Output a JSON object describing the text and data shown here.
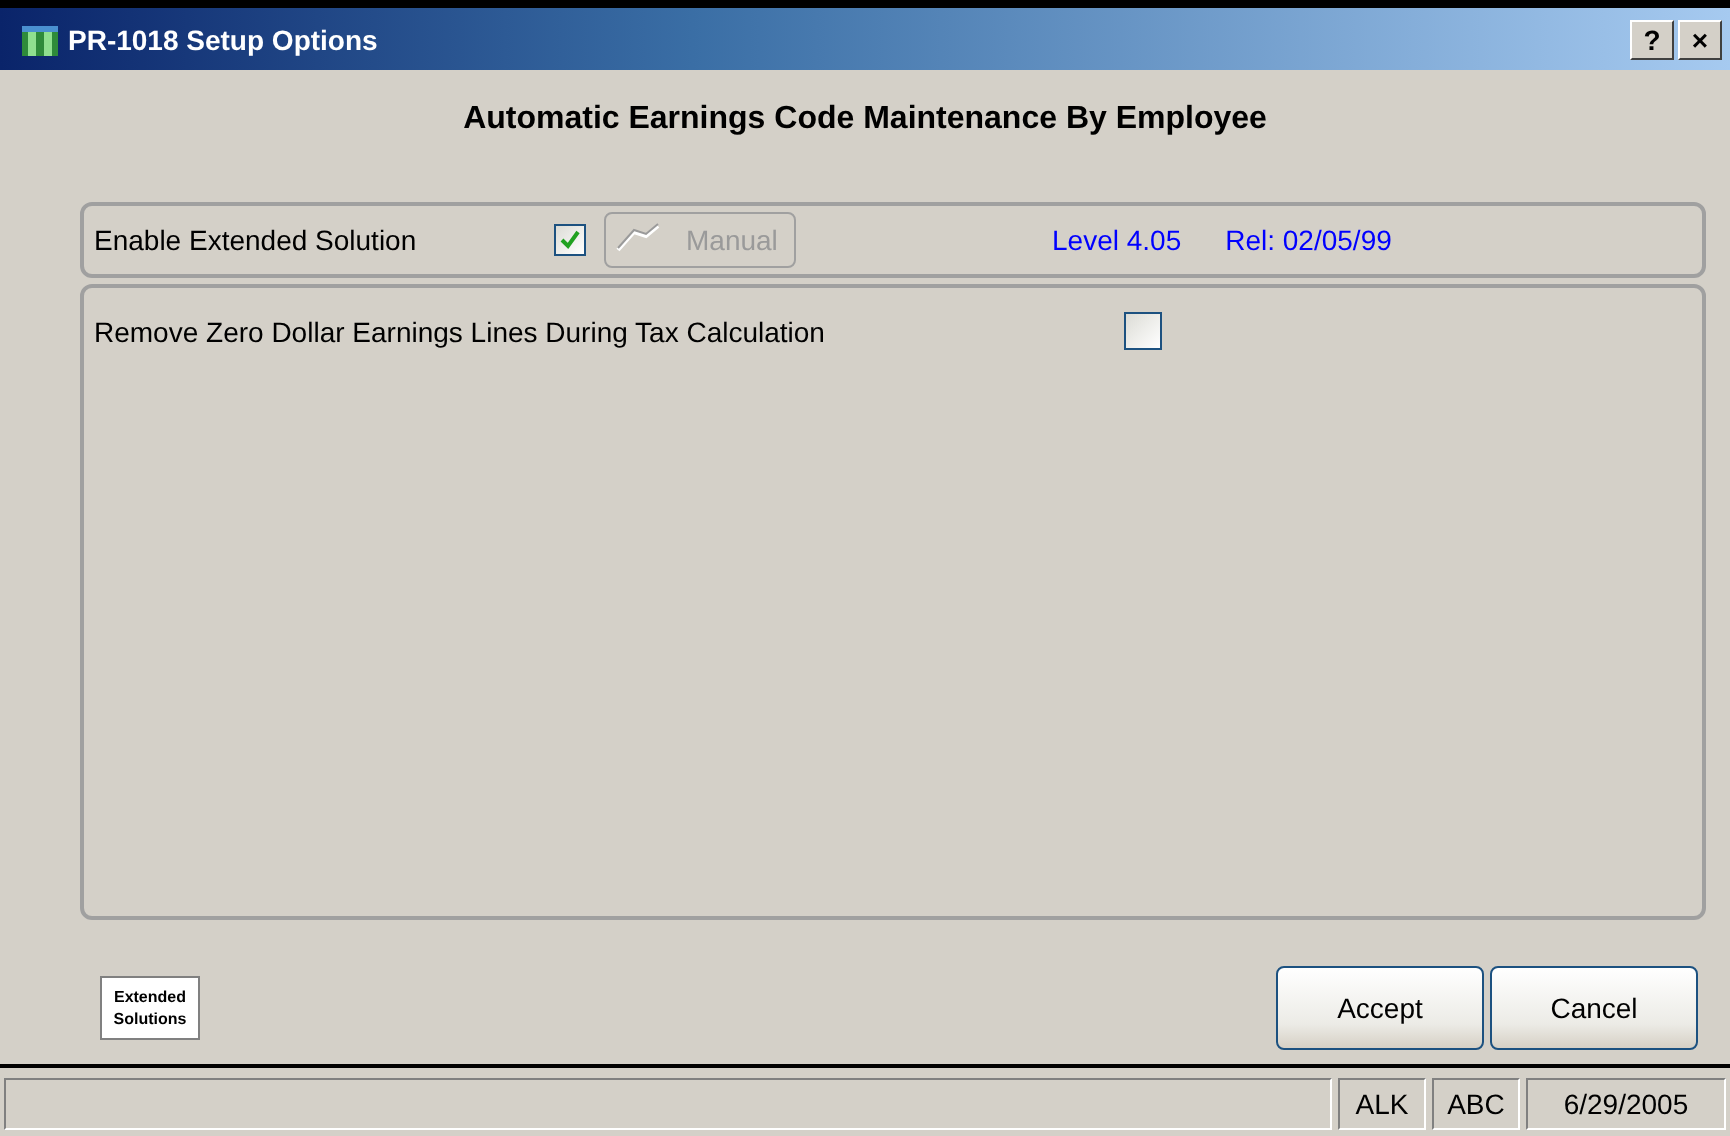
{
  "window": {
    "title": "PR-1018  Setup Options",
    "help_button": "?",
    "close_button": "×"
  },
  "heading": "Automatic Earnings Code Maintenance By Employee",
  "solution": {
    "label": "Enable Extended Solution",
    "checked": true,
    "manual_button": {
      "label": "Manual",
      "disabled": true
    },
    "level": "Level 4.05",
    "release": "Rel: 02/05/99"
  },
  "options": [
    {
      "label": "Remove Zero Dollar Earnings Lines During Tax Calculation",
      "checked": false
    }
  ],
  "logo": {
    "line_1": "Extended",
    "line_2": "Solutions"
  },
  "buttons": [
    "Accept",
    "Cancel"
  ],
  "status_bar": [
    "ALK",
    "ABC",
    "6/29/2005"
  ]
}
